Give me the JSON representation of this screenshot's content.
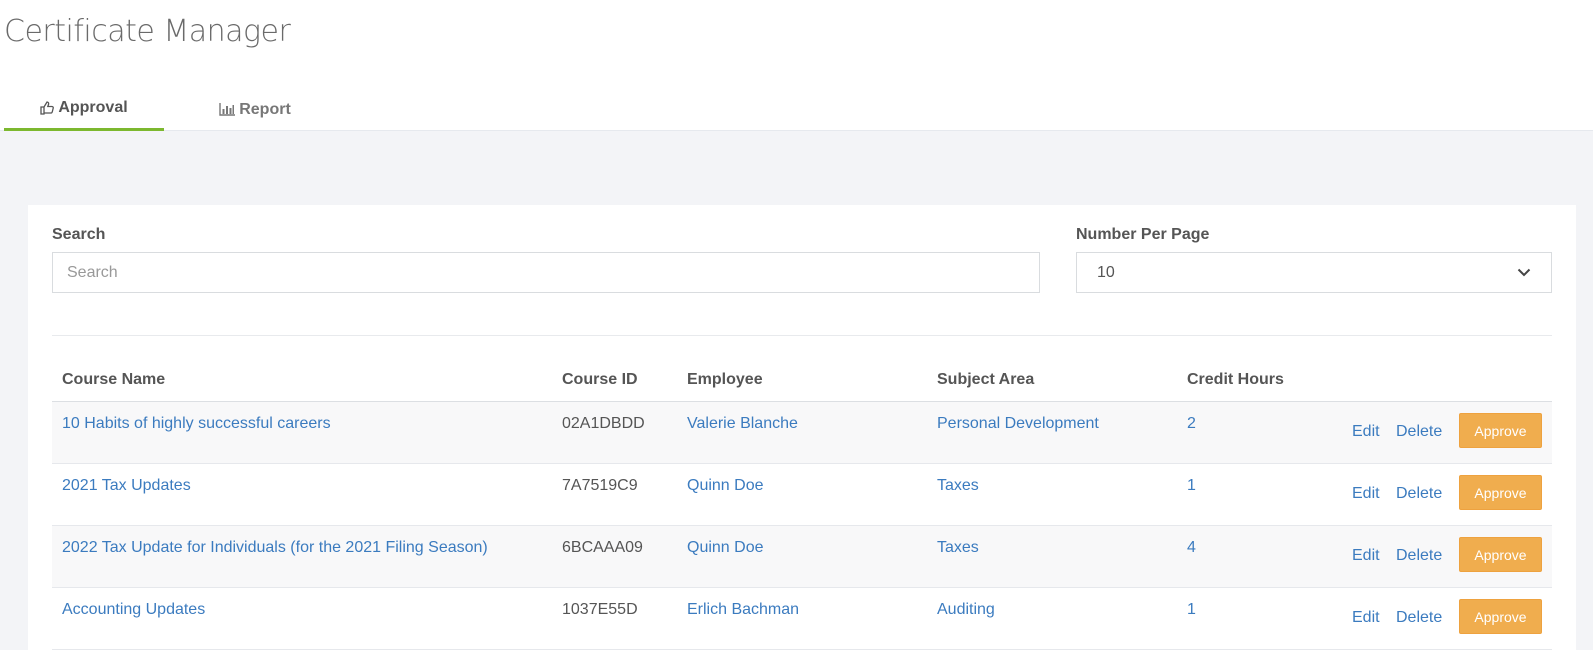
{
  "page": {
    "title": "Certificate Manager"
  },
  "tabs": [
    {
      "label": "Approval",
      "icon": "thumbs-up-icon",
      "active": true
    },
    {
      "label": "Report",
      "icon": "bar-chart-icon",
      "active": false
    }
  ],
  "colors": {
    "accent": "#7cb82f",
    "link": "#3b7bbf",
    "approve_button": "#f0ad4e"
  },
  "search": {
    "label": "Search",
    "placeholder": "Search",
    "value": ""
  },
  "per_page": {
    "label": "Number Per Page",
    "value": "10"
  },
  "table": {
    "columns": [
      "Course Name",
      "Course ID",
      "Employee",
      "Subject Area",
      "Credit Hours"
    ],
    "actions": {
      "edit": "Edit",
      "delete": "Delete",
      "approve": "Approve"
    },
    "rows": [
      {
        "course_name": "10 Habits of highly successful careers",
        "course_id": "02A1DBDD",
        "employee": "Valerie Blanche",
        "subject_area": "Personal Development",
        "credit_hours": "2"
      },
      {
        "course_name": "2021 Tax Updates",
        "course_id": "7A7519C9",
        "employee": "Quinn Doe",
        "subject_area": "Taxes",
        "credit_hours": "1"
      },
      {
        "course_name": "2022 Tax Update for Individuals (for the 2021 Filing Season)",
        "course_id": "6BCAAA09",
        "employee": "Quinn Doe",
        "subject_area": "Taxes",
        "credit_hours": "4"
      },
      {
        "course_name": "Accounting Updates",
        "course_id": "1037E55D",
        "employee": "Erlich Bachman",
        "subject_area": "Auditing",
        "credit_hours": "1"
      }
    ]
  }
}
